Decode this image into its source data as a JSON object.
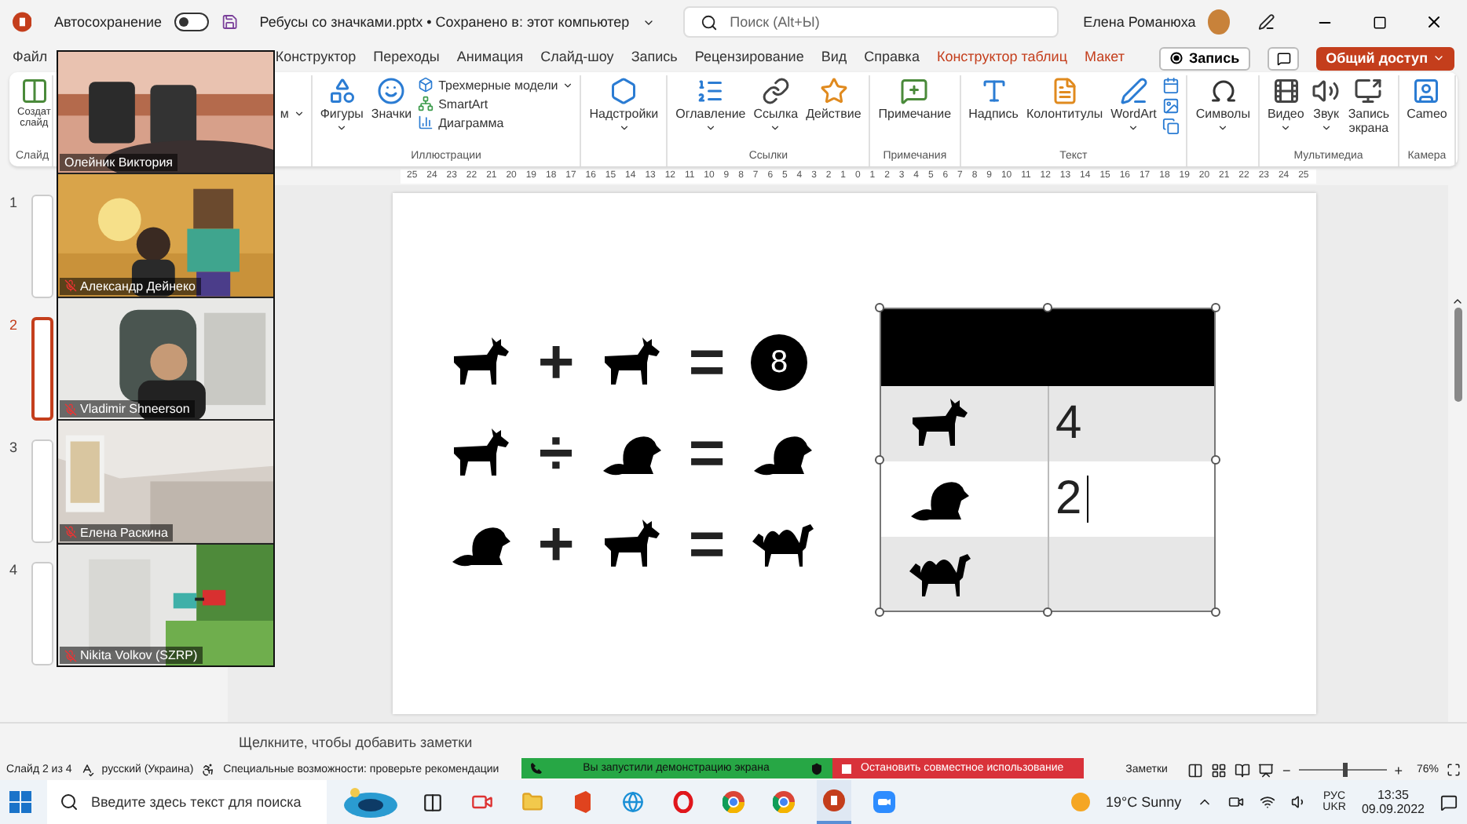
{
  "titlebar": {
    "autosave": {
      "label": "Автосохранение",
      "on": false
    },
    "document": "Ребусы со значками.pptx • Сохранено в: этот компьютер",
    "search": {
      "placeholder": "Поиск (Alt+Ы)"
    },
    "user": "Елена Романюха"
  },
  "menu": {
    "tabs": [
      {
        "label": "Файл",
        "selected": false,
        "kind": "normal"
      },
      {
        "label": "Конструктор",
        "selected": false,
        "kind": "normal"
      },
      {
        "label": "Переходы",
        "selected": false,
        "kind": "normal"
      },
      {
        "label": "Анимация",
        "selected": false,
        "kind": "normal"
      },
      {
        "label": "Слайд-шоу",
        "selected": false,
        "kind": "normal"
      },
      {
        "label": "Запись",
        "selected": false,
        "kind": "normal"
      },
      {
        "label": "Рецензирование",
        "selected": false,
        "kind": "normal"
      },
      {
        "label": "Вид",
        "selected": false,
        "kind": "normal"
      },
      {
        "label": "Справка",
        "selected": false,
        "kind": "normal"
      },
      {
        "label": "Конструктор таблиц",
        "selected": false,
        "kind": "context"
      },
      {
        "label": "Макет",
        "selected": false,
        "kind": "context"
      }
    ],
    "record": "Запись",
    "share": "Общий доступ"
  },
  "ribbon": {
    "groups": [
      {
        "label": "Слайд",
        "items": [
          {
            "label": "Создат\nслайд",
            "kind": "large",
            "dropdown": false
          }
        ]
      },
      {
        "items": [
          {
            "label": "м",
            "kind": "text",
            "dropdown": true
          }
        ]
      },
      {
        "label": "Иллюстрации",
        "items": [
          {
            "label": "Фигуры",
            "kind": "large",
            "dropdown": true
          },
          {
            "label": "Значки",
            "kind": "large",
            "dropdown": false
          },
          {
            "label": "Трехмерные модели",
            "kind": "small",
            "dropdown": true
          },
          {
            "label": "SmartArt",
            "kind": "small",
            "dropdown": false
          },
          {
            "label": "Диаграмма",
            "kind": "small",
            "dropdown": false
          }
        ]
      },
      {
        "items": [
          {
            "label": "Надстройки",
            "kind": "large",
            "dropdown": true
          }
        ]
      },
      {
        "label": "Ссылки",
        "items": [
          {
            "label": "Оглавление",
            "kind": "large",
            "dropdown": true
          },
          {
            "label": "Ссылка",
            "kind": "large",
            "dropdown": true
          },
          {
            "label": "Действие",
            "kind": "large",
            "dropdown": false
          }
        ]
      },
      {
        "label": "Примечания",
        "items": [
          {
            "label": "Примечание",
            "kind": "large",
            "dropdown": false
          }
        ]
      },
      {
        "label": "Текст",
        "items": [
          {
            "label": "Надпись",
            "kind": "large",
            "dropdown": false
          },
          {
            "label": "Колонтитулы",
            "kind": "large",
            "dropdown": false
          },
          {
            "label": "WordArt",
            "kind": "large",
            "dropdown": true
          },
          {
            "kind": "icons"
          }
        ]
      },
      {
        "items": [
          {
            "label": "Символы",
            "kind": "large",
            "dropdown": true
          }
        ]
      },
      {
        "label": "Мультимедиа",
        "items": [
          {
            "label": "Видео",
            "kind": "large",
            "dropdown": true
          },
          {
            "label": "Звук",
            "kind": "large",
            "dropdown": true
          },
          {
            "label": "Запись\nэкрана",
            "kind": "large",
            "dropdown": false
          }
        ]
      },
      {
        "label": "Камера",
        "items": [
          {
            "label": "Cameo",
            "kind": "large",
            "dropdown": false
          }
        ]
      }
    ]
  },
  "ruler": {
    "labels": [
      "25",
      "24",
      "23",
      "22",
      "21",
      "20",
      "19",
      "18",
      "17",
      "16",
      "15",
      "14",
      "13",
      "12",
      "11",
      "10",
      "9",
      "8",
      "7",
      "6",
      "5",
      "4",
      "3",
      "2",
      "1",
      "0",
      "1",
      "2",
      "3",
      "4",
      "5",
      "6",
      "7",
      "8",
      "9",
      "10",
      "11",
      "12",
      "13",
      "14",
      "15",
      "16",
      "17",
      "18",
      "19",
      "20",
      "21",
      "22",
      "23",
      "24",
      "25"
    ]
  },
  "thumbnails": [
    {
      "number": "1",
      "selected": false
    },
    {
      "number": "2",
      "selected": true
    },
    {
      "number": "3",
      "selected": false
    },
    {
      "number": "4",
      "selected": false
    }
  ],
  "slide": {
    "equations": [
      [
        {
          "kind": "goat"
        },
        {
          "kind": "op",
          "text": "+"
        },
        {
          "kind": "goat"
        },
        {
          "kind": "op",
          "text": "="
        },
        {
          "kind": "number",
          "text": "8"
        }
      ],
      [
        {
          "kind": "goat"
        },
        {
          "kind": "op",
          "text": "÷"
        },
        {
          "kind": "beaver"
        },
        {
          "kind": "op",
          "text": "="
        },
        {
          "kind": "beaver"
        }
      ],
      [
        {
          "kind": "beaver"
        },
        {
          "kind": "op",
          "text": "+"
        },
        {
          "kind": "goat"
        },
        {
          "kind": "op",
          "text": "="
        },
        {
          "kind": "camel"
        }
      ]
    ],
    "table": {
      "selected": true,
      "rows": [
        {
          "kind": "header"
        },
        {
          "kind": "body",
          "cells": [
            {
              "kind": "goat"
            },
            {
              "kind": "text",
              "text": "4",
              "editing": false
            }
          ]
        },
        {
          "kind": "body",
          "cells": [
            {
              "kind": "beaver"
            },
            {
              "kind": "text",
              "text": "2",
              "editing": true
            }
          ]
        },
        {
          "kind": "body",
          "cells": [
            {
              "kind": "camel"
            },
            {
              "kind": "empty"
            }
          ]
        }
      ]
    }
  },
  "notes": {
    "placeholder": "Щелкните, чтобы добавить заметки"
  },
  "status": {
    "slide": "Слайд 2 из 4",
    "language": "русский (Украина)",
    "accessibility": "Специальные возможности: проверьте рекомендации",
    "notes": "Заметки",
    "zoom_out": "−",
    "zoom_in": "+",
    "zoom": {
      "level": 0.5
    },
    "zoom_value": "76%"
  },
  "screen_share": {
    "notice": "Вы запустили демонстрацию экрана",
    "stop": "Остановить совместное использование"
  },
  "participants": [
    {
      "name": "Олейник Виктория",
      "muted": false
    },
    {
      "name": "Александр Дейнеко",
      "muted": true
    },
    {
      "name": "Vladimir Shneerson",
      "muted": true
    },
    {
      "name": "Елена Раскина",
      "muted": true
    },
    {
      "name": "Nikita Volkov (SZRP)",
      "muted": true
    }
  ],
  "taskbar": {
    "search": {
      "placeholder": "Введите здесь текст для поиска"
    },
    "weather": "19°C Sunny",
    "language": [
      "РУС",
      "UKR"
    ],
    "time": "13:35",
    "date": "09.09.2022"
  }
}
